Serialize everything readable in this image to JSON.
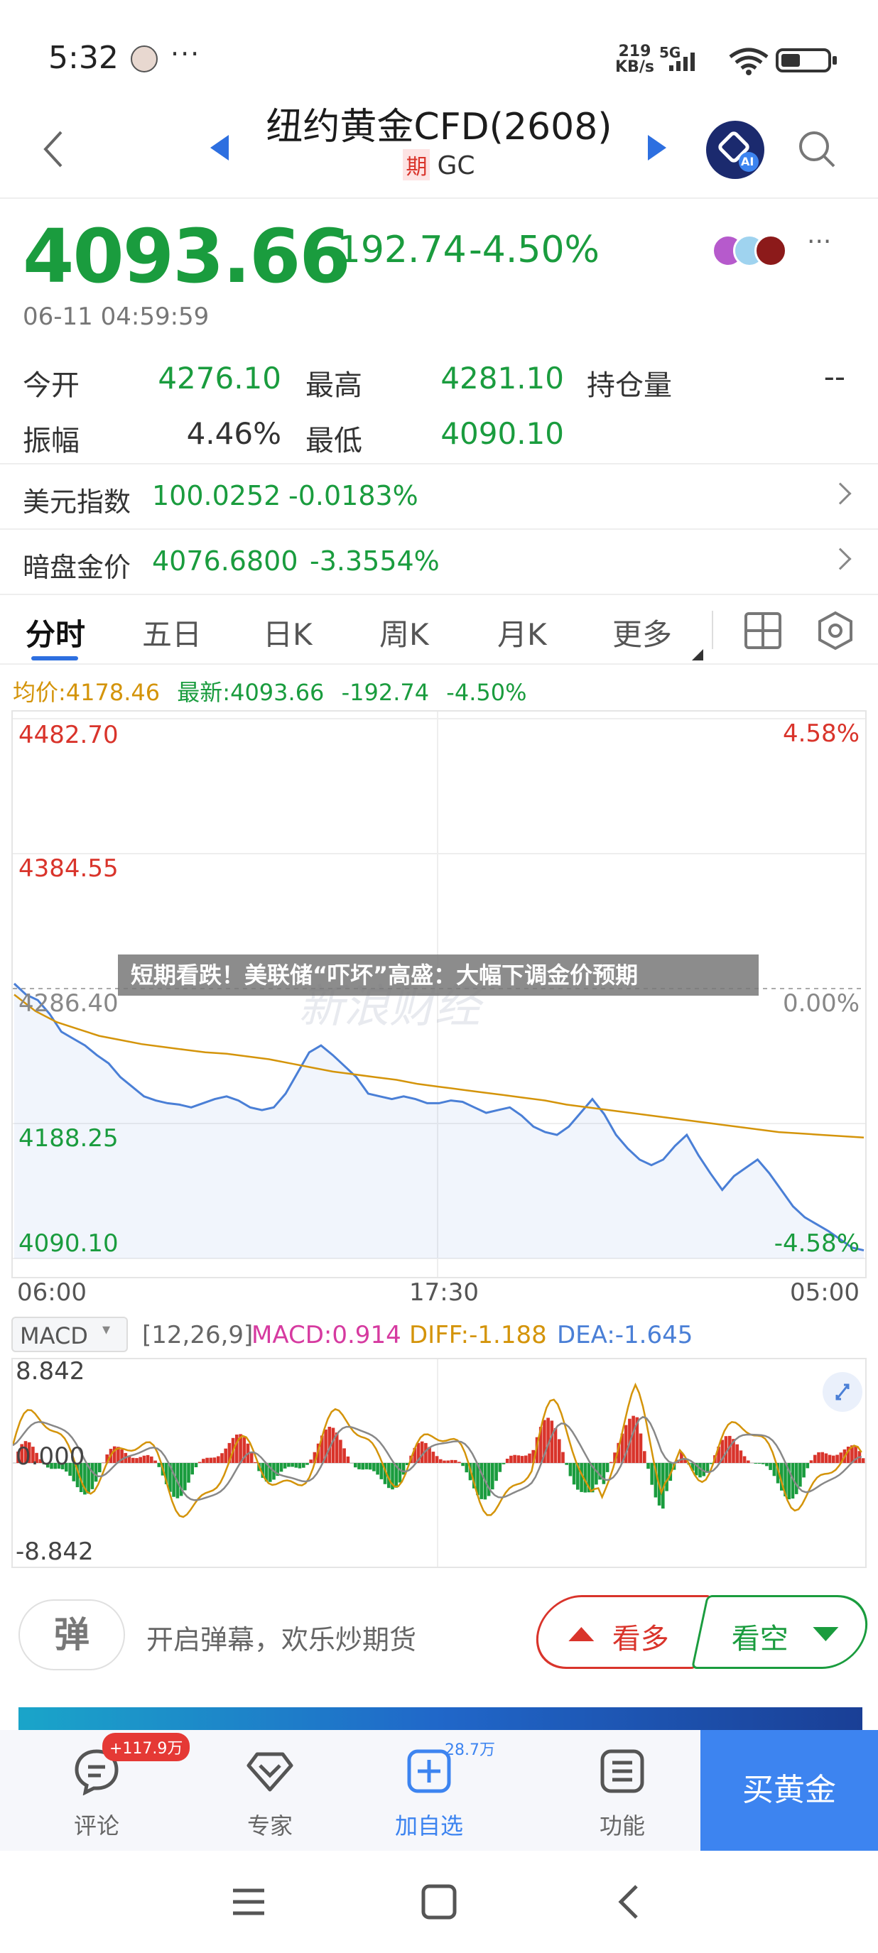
{
  "status_bar": {
    "time": "5:32",
    "more": "···",
    "speed_value": "219",
    "speed_unit": "KB/s",
    "network": "5G"
  },
  "header": {
    "title": "纽约黄金CFD(2608)",
    "badge": "期",
    "code": "GC",
    "ai_label": "AI"
  },
  "quote": {
    "price": "4093.66",
    "change": "-192.74",
    "change_pct": "-4.50%",
    "timestamp": "06-11 04:59:59",
    "more": "···"
  },
  "stats": {
    "open_label": "今开",
    "open_value": "4276.10",
    "high_label": "最高",
    "high_value": "4281.10",
    "oi_label": "持仓量",
    "oi_value": "--",
    "amp_label": "振幅",
    "amp_value": "4.46%",
    "low_label": "最低",
    "low_value": "4090.10"
  },
  "related": [
    {
      "label": "美元指数",
      "value": "100.0252",
      "pct": "-0.0183%"
    },
    {
      "label": "暗盘金价",
      "value": "4076.6800",
      "pct": "-3.3554%"
    }
  ],
  "tabs": [
    "分时",
    "五日",
    "日K",
    "周K",
    "月K",
    "更多"
  ],
  "chart_header": {
    "avg": "均价:4178.46",
    "latest": "最新:4093.66",
    "change": "-192.74",
    "pct": "-4.50%"
  },
  "chart_data": [
    {
      "type": "line",
      "title": "",
      "x_ticks": [
        "06:00",
        "17:30",
        "05:00"
      ],
      "y_ticks_left": [
        "4482.70",
        "4384.55",
        "4286.40",
        "4188.25",
        "4090.10"
      ],
      "y_ticks_right": [
        "4.58%",
        "0.00%",
        "-4.58%"
      ],
      "ylim": [
        4090.1,
        4482.7
      ],
      "series": [
        {
          "name": "",
          "color": "#4a7fd6",
          "values": [
            4290,
            4282,
            4278,
            4268,
            4255,
            4250,
            4245,
            4238,
            4232,
            4222,
            4215,
            4208,
            4205,
            4203,
            4202,
            4200,
            4203,
            4206,
            4208,
            4205,
            4200,
            4198,
            4200,
            4210,
            4225,
            4240,
            4245,
            4238,
            4230,
            4222,
            4210,
            4208,
            4206,
            4208,
            4206,
            4203,
            4203,
            4205,
            4204,
            4200,
            4196,
            4198,
            4200,
            4194,
            4186,
            4182,
            4180,
            4186,
            4196,
            4206,
            4195,
            4180,
            4170,
            4162,
            4158,
            4162,
            4172,
            4180,
            4165,
            4152,
            4140,
            4150,
            4156,
            4162,
            4152,
            4140,
            4128,
            4120,
            4115,
            4110,
            4104,
            4098,
            4096
          ]
        },
        {
          "name": "",
          "color": "#d4940a",
          "values": [
            4282,
            4270,
            4262,
            4257,
            4252,
            4249,
            4246,
            4244,
            4242,
            4240,
            4239,
            4237,
            4235,
            4232,
            4229,
            4226,
            4224,
            4222,
            4220,
            4217,
            4215,
            4213,
            4211,
            4209,
            4207,
            4205,
            4202,
            4200,
            4198,
            4196,
            4194,
            4192,
            4190,
            4188,
            4186,
            4184,
            4182,
            4181,
            4180,
            4179,
            4178
          ]
        }
      ]
    },
    {
      "type": "bar",
      "title": "MACD",
      "params": "[12,26,9]",
      "y_ticks": [
        "8.842",
        "0.000",
        "-8.842"
      ],
      "ylim": [
        -8.842,
        8.842
      ],
      "macd": "MACD:0.914",
      "diff": "DIFF:-1.188",
      "dea": "DEA:-1.645"
    }
  ],
  "headline": "短期看跌！美联储“吓坏”高盛：大幅下调金价预期",
  "watermark": "新浪财经",
  "macd_select": "MACD",
  "danmaku": {
    "button": "弹",
    "text": "开启弹幕，欢乐炒期货"
  },
  "sentiment": {
    "bull": "看多",
    "bear": "看空"
  },
  "bottom_nav": {
    "comment_label": "评论",
    "comment_badge": "+117.9万",
    "expert_label": "专家",
    "watch_label": "加自选",
    "watch_count": "28.7万",
    "func_label": "功能",
    "buy_label": "买黄金"
  },
  "colors": {
    "up": "#d9342b",
    "down": "#1a9c3e",
    "accent": "#2d6fe0",
    "avg_line": "#d4940a"
  }
}
